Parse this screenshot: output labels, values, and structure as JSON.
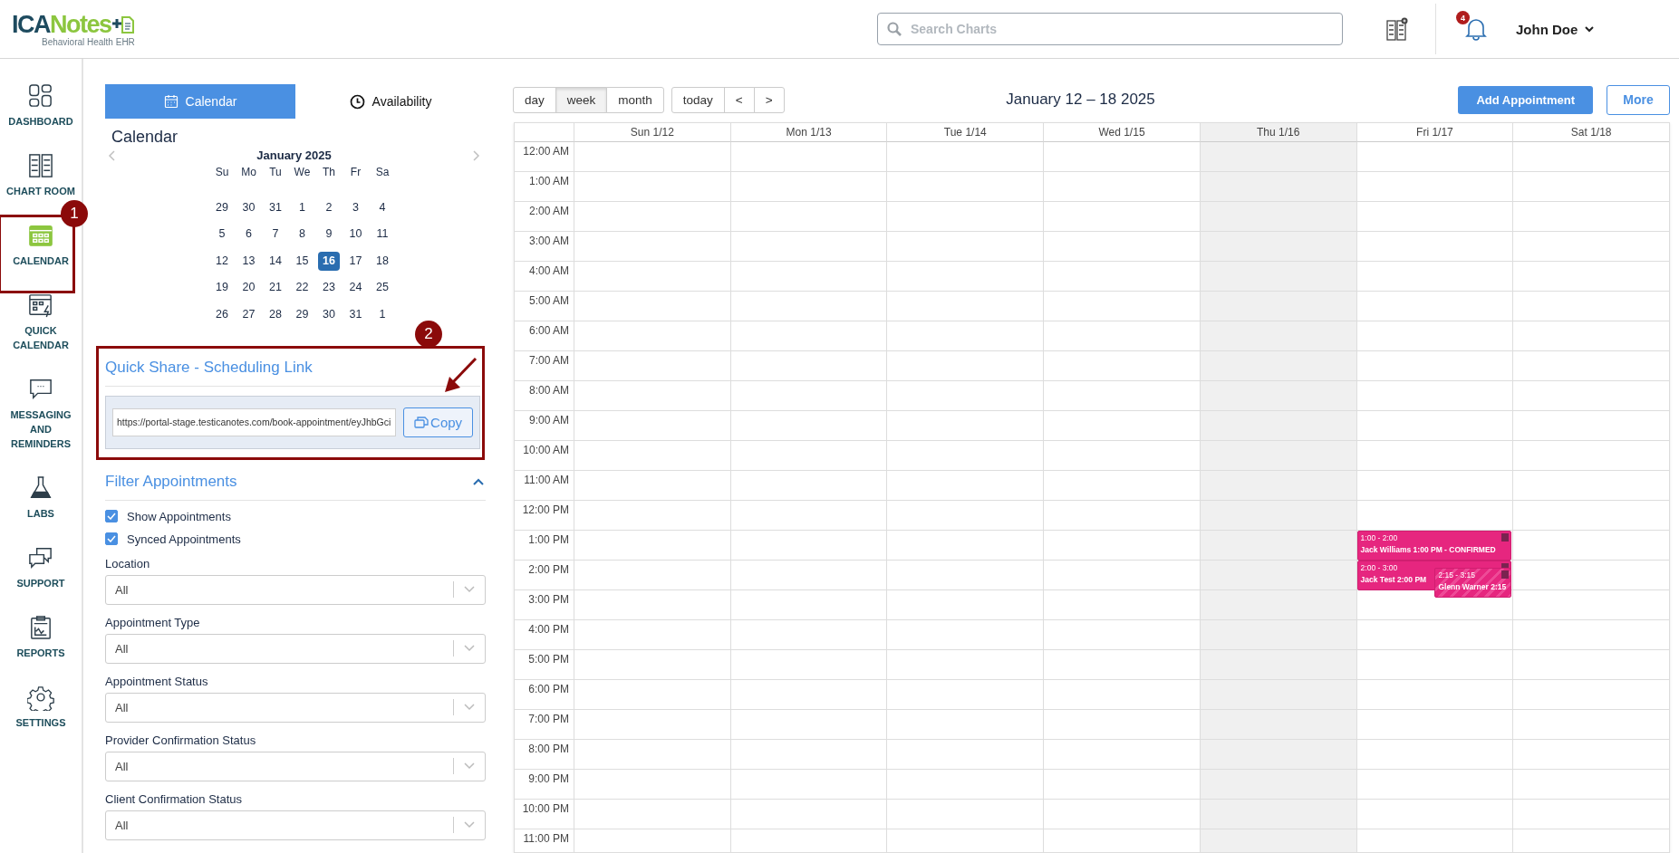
{
  "header": {
    "logo": {
      "primary": "ICA",
      "secondary": "Notes",
      "tagline": "Behavioral Health EHR"
    },
    "search": {
      "placeholder": "Search Charts"
    },
    "notifications": "4",
    "user": "John Doe"
  },
  "nav": [
    {
      "label": "DASHBOARD",
      "selected": false
    },
    {
      "label": "CHART ROOM",
      "selected": false
    },
    {
      "label": "CALENDAR",
      "selected": true,
      "callout": "1"
    },
    {
      "label": "QUICK CALENDAR",
      "selected": false
    },
    {
      "label": "MESSAGING AND REMINDERS",
      "selected": false
    },
    {
      "label": "LABS",
      "selected": false
    },
    {
      "label": "SUPPORT",
      "selected": false
    },
    {
      "label": "REPORTS",
      "selected": false
    },
    {
      "label": "SETTINGS",
      "selected": false
    }
  ],
  "panel_tabs": [
    {
      "label": "Calendar",
      "selected": true
    },
    {
      "label": "Availability",
      "selected": false
    }
  ],
  "mini_calendar": {
    "title": "Calendar",
    "month": "January 2025",
    "weekdays": [
      "Su",
      "Mo",
      "Tu",
      "We",
      "Th",
      "Fr",
      "Sa"
    ],
    "weeks": [
      [
        {
          "day": "29",
          "selected": false
        },
        {
          "day": "30",
          "selected": false
        },
        {
          "day": "31",
          "selected": false
        },
        {
          "day": "1",
          "selected": false
        },
        {
          "day": "2",
          "selected": false
        },
        {
          "day": "3",
          "selected": false
        },
        {
          "day": "4",
          "selected": false
        }
      ],
      [
        {
          "day": "5",
          "selected": false
        },
        {
          "day": "6",
          "selected": false
        },
        {
          "day": "7",
          "selected": false
        },
        {
          "day": "8",
          "selected": false
        },
        {
          "day": "9",
          "selected": false
        },
        {
          "day": "10",
          "selected": false
        },
        {
          "day": "11",
          "selected": false
        }
      ],
      [
        {
          "day": "12",
          "selected": false
        },
        {
          "day": "13",
          "selected": false
        },
        {
          "day": "14",
          "selected": false
        },
        {
          "day": "15",
          "selected": false
        },
        {
          "day": "16",
          "selected": true
        },
        {
          "day": "17",
          "selected": false
        },
        {
          "day": "18",
          "selected": false
        }
      ],
      [
        {
          "day": "19",
          "selected": false
        },
        {
          "day": "20",
          "selected": false
        },
        {
          "day": "21",
          "selected": false
        },
        {
          "day": "22",
          "selected": false
        },
        {
          "day": "23",
          "selected": false
        },
        {
          "day": "24",
          "selected": false
        },
        {
          "day": "25",
          "selected": false
        }
      ],
      [
        {
          "day": "26",
          "selected": false
        },
        {
          "day": "27",
          "selected": false
        },
        {
          "day": "28",
          "selected": false
        },
        {
          "day": "29",
          "selected": false
        },
        {
          "day": "30",
          "selected": false
        },
        {
          "day": "31",
          "selected": false
        },
        {
          "day": "1",
          "selected": false
        }
      ]
    ]
  },
  "quick_share": {
    "title": "Quick Share - Scheduling Link",
    "url": "https://portal-stage.testicanotes.com/book-appointment/eyJhbGci",
    "button": "Copy",
    "callout": "2"
  },
  "filters": {
    "title": "Filter Appointments",
    "expanded": true,
    "checkboxes": [
      {
        "label": "Show Appointments",
        "checked": true
      },
      {
        "label": "Synced Appointments",
        "checked": true
      }
    ],
    "dropdowns": [
      {
        "label": "Location",
        "value": "All"
      },
      {
        "label": "Appointment Type",
        "value": "All"
      },
      {
        "label": "Appointment Status",
        "value": "All"
      },
      {
        "label": "Provider Confirmation Status",
        "value": "All"
      },
      {
        "label": "Client Confirmation Status",
        "value": "All"
      }
    ]
  },
  "toolbar": {
    "views": [
      {
        "label": "day",
        "selected": false
      },
      {
        "label": "week",
        "selected": true
      },
      {
        "label": "month",
        "selected": false
      }
    ],
    "nav": [
      "today",
      "<",
      ">"
    ],
    "range": "January 12 – 18 2025",
    "add_button": "Add Appointment",
    "more_button": "More"
  },
  "days": [
    {
      "label": "Sun 1/12",
      "today": false
    },
    {
      "label": "Mon 1/13",
      "today": false
    },
    {
      "label": "Tue 1/14",
      "today": false
    },
    {
      "label": "Wed 1/15",
      "today": false
    },
    {
      "label": "Thu 1/16",
      "today": true
    },
    {
      "label": "Fri 1/17",
      "today": false,
      "events": [
        {
          "time": "1:00 - 2:00",
          "title": "Jack Williams 1:00 PM - CONFIRMED",
          "kind": "regular"
        },
        {
          "time": "2:00 - 3:00",
          "title": "Jack Test 2:00 PM",
          "kind": "regular"
        },
        {
          "time": "2:15 - 3:15",
          "title": "Glenn Warner 2:15",
          "kind": "overlay"
        }
      ]
    },
    {
      "label": "Sat 1/18",
      "today": false
    }
  ],
  "hours": [
    "12:00 AM",
    "1:00 AM",
    "2:00 AM",
    "3:00 AM",
    "4:00 AM",
    "5:00 AM",
    "6:00 AM",
    "7:00 AM",
    "8:00 AM",
    "9:00 AM",
    "10:00 AM",
    "11:00 AM",
    "12:00 PM",
    "1:00 PM",
    "2:00 PM",
    "3:00 PM",
    "4:00 PM",
    "5:00 PM",
    "6:00 PM",
    "7:00 PM",
    "8:00 PM",
    "9:00 PM",
    "10:00 PM",
    "11:00 PM"
  ]
}
